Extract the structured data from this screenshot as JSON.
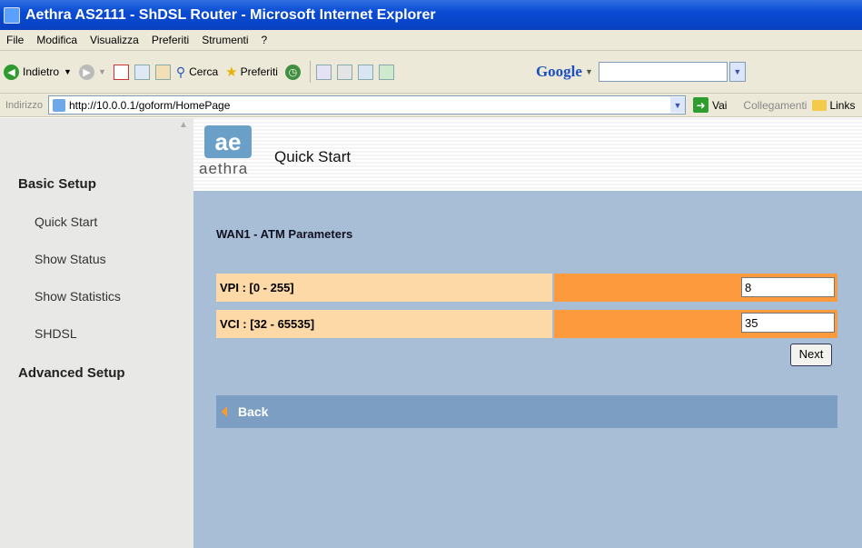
{
  "window": {
    "title": "Aethra AS2111 - ShDSL Router - Microsoft Internet Explorer"
  },
  "menu": [
    "File",
    "Modifica",
    "Visualizza",
    "Preferiti",
    "Strumenti",
    "?"
  ],
  "toolbar": {
    "back": "Indietro",
    "search": "Cerca",
    "favorites": "Preferiti",
    "google": "Google"
  },
  "address": {
    "label": "Indirizzo",
    "url": "http://10.0.0.1/goform/HomePage",
    "go": "Vai",
    "links_label": "Collegamenti",
    "links": "Links"
  },
  "sidebar": {
    "basic_setup": "Basic Setup",
    "items": [
      "Quick Start",
      "Show Status",
      "Show Statistics",
      "SHDSL"
    ],
    "advanced_setup": "Advanced Setup"
  },
  "header": {
    "logo_mark": "ae",
    "logo_word": "aethra",
    "title": "Quick Start"
  },
  "form": {
    "section": "WAN1 - ATM Parameters",
    "vpi_label": "VPI : [0 - 255]",
    "vpi_value": "8",
    "vci_label": "VCI : [32 - 65535]",
    "vci_value": "35",
    "next": "Next",
    "back": "Back"
  }
}
